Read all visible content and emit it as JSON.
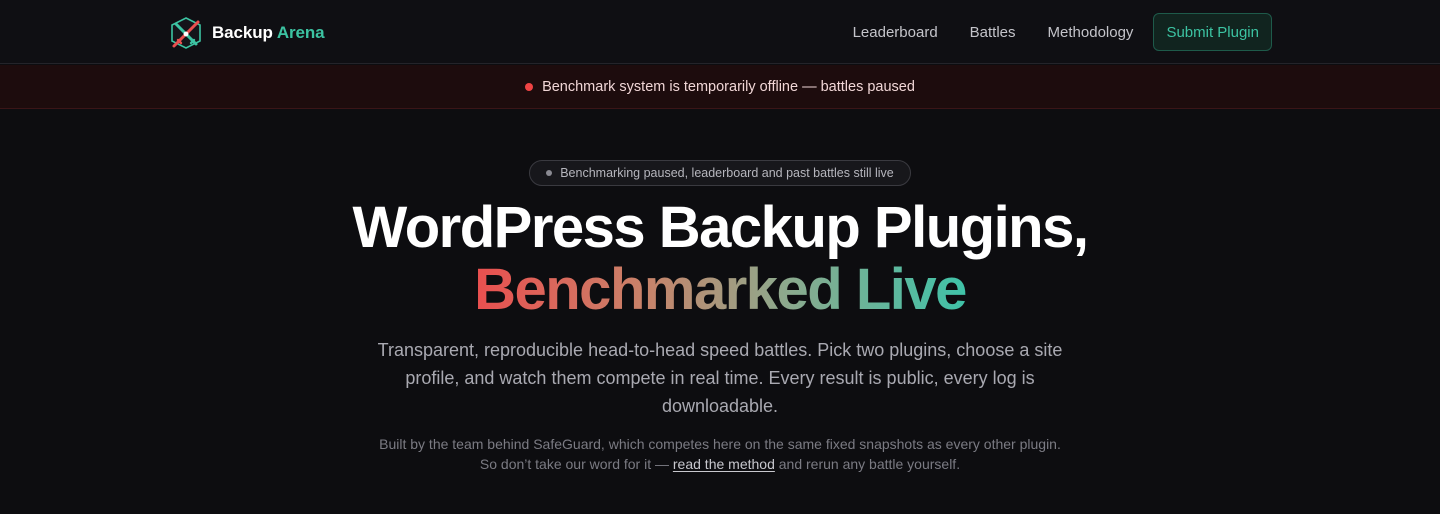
{
  "header": {
    "brand": {
      "name_primary": "Backup",
      "name_accent": "Arena",
      "logo_icon": "crossed-swords-icon"
    },
    "nav": [
      {
        "label": "Leaderboard"
      },
      {
        "label": "Battles"
      },
      {
        "label": "Methodology"
      }
    ],
    "submit_label": "Submit Plugin"
  },
  "alert": {
    "text": "Benchmark system is temporarily offline — battles paused",
    "status_color": "#ef4444"
  },
  "hero": {
    "pill_text": "Benchmarking paused, leaderboard and past battles still live",
    "headline_line1": "WordPress Backup Plugins,",
    "headline_line2": "Benchmarked Live",
    "lede": "Transparent, reproducible head-to-head speed battles. Pick two plugins, choose a site profile, and watch them compete in real time. Every result is public, every log is downloadable.",
    "note_before": "Built by the team behind SafeGuard, which competes here on the same fixed snapshots as every other plugin. So don’t take our word for it — ",
    "note_link": "read the method",
    "note_after": " and rerun any battle yourself."
  },
  "colors": {
    "accent": "#3cc3a2",
    "gradient_start": "#ea4f4f",
    "gradient_end": "#3fc2a8"
  }
}
